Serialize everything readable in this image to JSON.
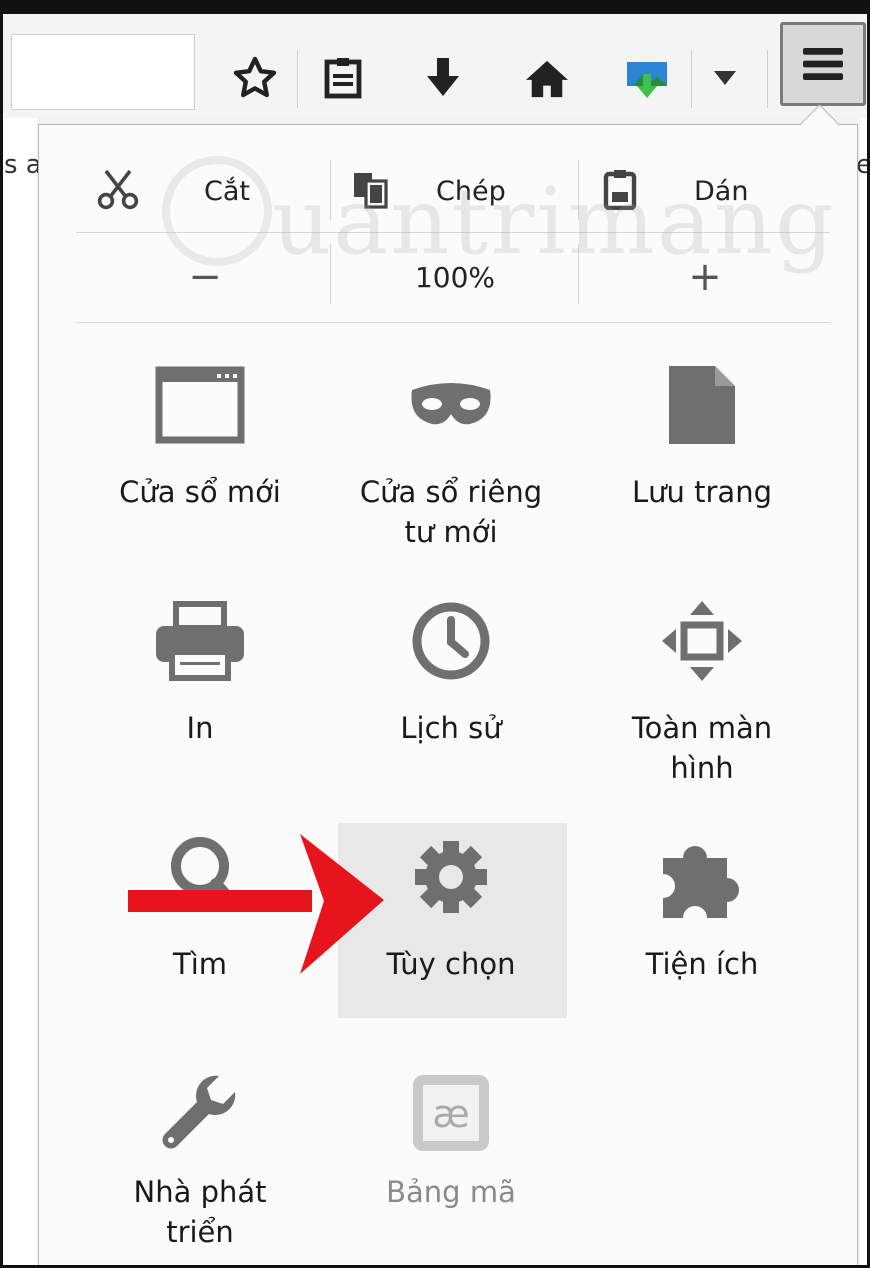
{
  "toolbar": {
    "icons": [
      "star-icon",
      "reading-list-icon",
      "download-icon",
      "home-icon",
      "extension-icon",
      "dropdown-icon",
      "hamburger-menu-icon"
    ]
  },
  "page_behind": {
    "left_fragment": "s a",
    "right_fragment": "e"
  },
  "edit": {
    "cut": "Cắt",
    "copy": "Chép",
    "paste": "Dán"
  },
  "zoom": {
    "minus": "−",
    "level": "100%",
    "plus": "+"
  },
  "watermark": "uantrimang",
  "items": [
    {
      "label": "Cửa sổ mới",
      "icon": "new-window-icon"
    },
    {
      "label": "Cửa sổ riêng\ntư mới",
      "icon": "private-mask-icon"
    },
    {
      "label": "Lưu trang",
      "icon": "save-page-icon"
    },
    {
      "label": "In",
      "icon": "printer-icon"
    },
    {
      "label": "Lịch sử",
      "icon": "history-clock-icon"
    },
    {
      "label": "Toàn màn\nhình",
      "icon": "fullscreen-icon"
    },
    {
      "label": "Tìm",
      "icon": "find-icon"
    },
    {
      "label": "Tùy chọn",
      "icon": "gear-icon"
    },
    {
      "label": "Tiện ích",
      "icon": "puzzle-icon"
    },
    {
      "label": "Nhà phát\ntriển",
      "icon": "wrench-icon"
    },
    {
      "label": "Bảng mã",
      "icon": "character-encoding-icon"
    }
  ],
  "colors": {
    "icon_gray": "#6f6f6f",
    "highlight": "#e8e8e8",
    "annotation_red": "#e8141b",
    "green": "#2bb24c"
  }
}
